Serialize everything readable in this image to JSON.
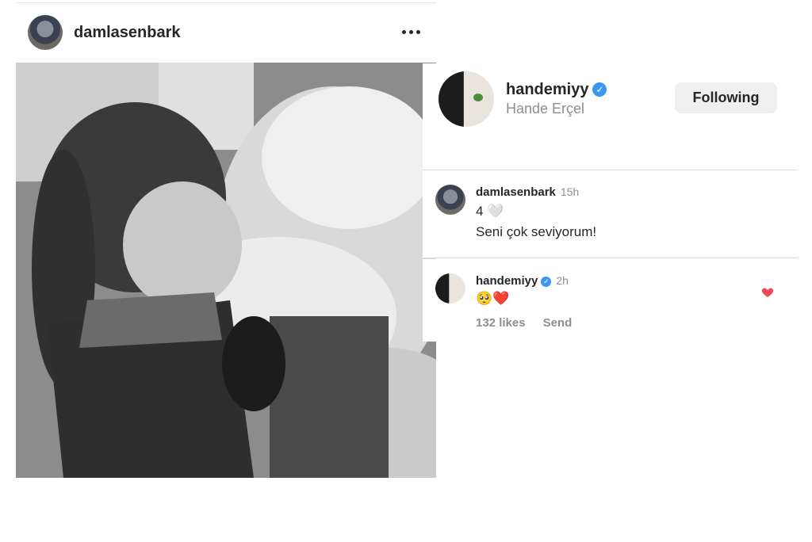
{
  "post": {
    "poster_username": "damlasenbark"
  },
  "owner": {
    "username": "handemiyy",
    "full_name": "Hande Erçel",
    "follow_button": "Following"
  },
  "comments": [
    {
      "username": "damlasenbark",
      "time": "15h",
      "line1": "4 🤍",
      "line2": "Seni çok seviyorum!"
    },
    {
      "username": "handemiyy",
      "time": "2h",
      "text": "🥺❤️",
      "likes": "132 likes",
      "send": "Send"
    }
  ],
  "icons": {
    "more": "more-options-icon",
    "verified": "verified-badge-icon",
    "like": "heart-icon"
  },
  "colors": {
    "verified": "#3897f0",
    "heart": "#ed4956",
    "muted_text": "#8e8e8e",
    "button_bg": "#efefef"
  }
}
